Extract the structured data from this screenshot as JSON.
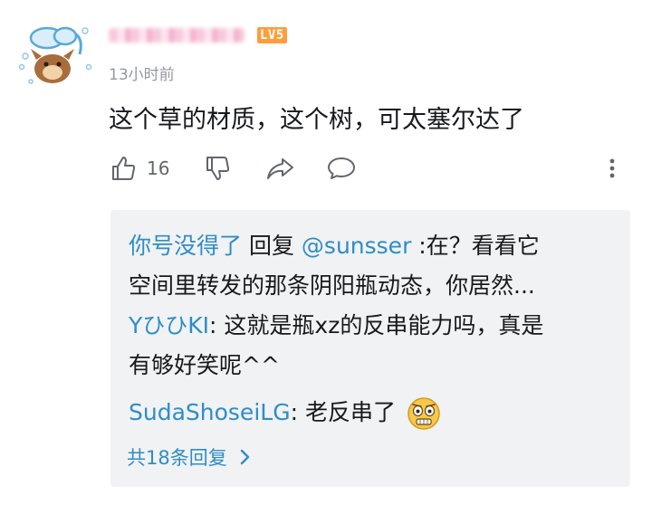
{
  "comment": {
    "level_badge": "LV5",
    "timestamp": "13小时前",
    "text": "这个草的材质，这个树，可太塞尔达了",
    "like_count": "16"
  },
  "replies": {
    "r1_user": "你号没得了",
    "r1_reply_word": " 回复 ",
    "r1_mention": "@sunsser",
    "r1_text_a": " :在？看看它",
    "r1_text_b": "空间里转发的那条阴阳瓶动态，你居然...",
    "r2_user": "YひひKI",
    "r2_text_a": ": 这就是瓶xz的反串能力吗，真是",
    "r2_text_b": "有够好笑呢^^",
    "r3_user": "SudaShoseiLG",
    "r3_text": ": 老反串了",
    "more_label": "共18条回复"
  },
  "icons": {
    "like": "thumbs-up-icon",
    "dislike": "thumbs-down-icon",
    "share": "share-icon",
    "reply": "comment-bubble-icon",
    "more": "more-vertical-icon",
    "chevron": "chevron-right-icon"
  },
  "colors": {
    "link": "#2e8dc7",
    "badge": "#ff9d3d",
    "meta": "#9499a0",
    "reply_bg": "#f1f2f3"
  }
}
